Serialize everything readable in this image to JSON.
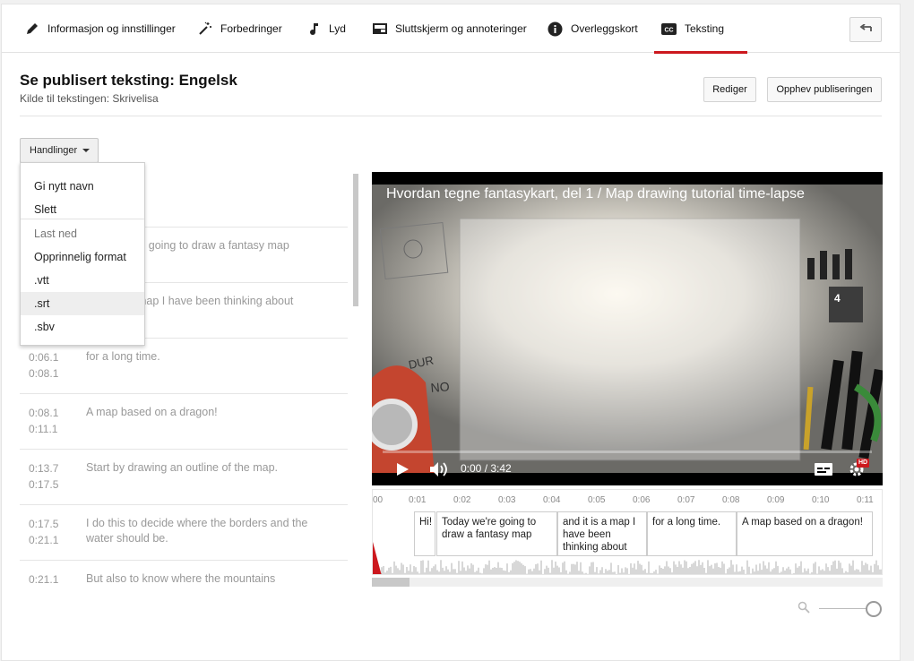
{
  "tabs": [
    {
      "label": "Informasjon og innstillinger",
      "icon": "pencil-icon"
    },
    {
      "label": "Forbedringer",
      "icon": "magic-wand-icon"
    },
    {
      "label": "Lyd",
      "icon": "music-note-icon"
    },
    {
      "label": "Sluttskjerm og annoteringer",
      "icon": "end-screen-icon"
    },
    {
      "label": "Overleggskort",
      "icon": "info-icon"
    },
    {
      "label": "Teksting",
      "icon": "cc-icon"
    }
  ],
  "back_button": {
    "icon": "back-arrow-icon"
  },
  "header": {
    "title": "Se publisert teksting: Engelsk",
    "source": "Kilde til tekstingen: Skrivelisa"
  },
  "buttons": {
    "edit": "Rediger",
    "unpublish": "Opphev publiseringen"
  },
  "actions": {
    "label": "Handlinger"
  },
  "menu": {
    "items": [
      "Gi nytt navn",
      "Slett"
    ],
    "download_header": "Last ned",
    "formats": [
      "Opprinnelig format",
      ".vtt",
      ".srt",
      ".sbv"
    ]
  },
  "captions": [
    {
      "start": "",
      "end": "",
      "text": ""
    },
    {
      "start": "",
      "end": "",
      "text": "Today we're going to draw a fantasy map"
    },
    {
      "start": "",
      "end": "",
      "text": "and it is a map I have been thinking about"
    },
    {
      "start": "0:06.1",
      "end": "0:08.1",
      "text": "for a long time."
    },
    {
      "start": "0:08.1",
      "end": "0:11.1",
      "text": "A map based on a dragon!"
    },
    {
      "start": "0:13.7",
      "end": "0:17.5",
      "text": "Start by drawing an outline of the map."
    },
    {
      "start": "0:17.5",
      "end": "0:21.1",
      "text": "I do this to decide where the borders and the water should be."
    },
    {
      "start": "0:21.1",
      "end": "",
      "text": "But also to know where the mountains"
    }
  ],
  "video": {
    "title": "Hvordan tegne fantasykart, del 1 / Map drawing tutorial time-lapse",
    "time": "0:00 / 3:42",
    "hd_badge": "HD",
    "progress": 0
  },
  "timeline": {
    "ticks": [
      "00",
      "0:01",
      "0:02",
      "0:03",
      "0:04",
      "0:05",
      "0:06",
      "0:07",
      "0:08",
      "0:09",
      "0:10",
      "0:11"
    ],
    "cues": [
      "Hi!",
      "Today we're going to draw a fantasy map",
      "and it is a map I have been thinking about",
      "for a long time.",
      "A map based on a dragon!"
    ]
  },
  "colors": {
    "accent": "#cc181e"
  }
}
